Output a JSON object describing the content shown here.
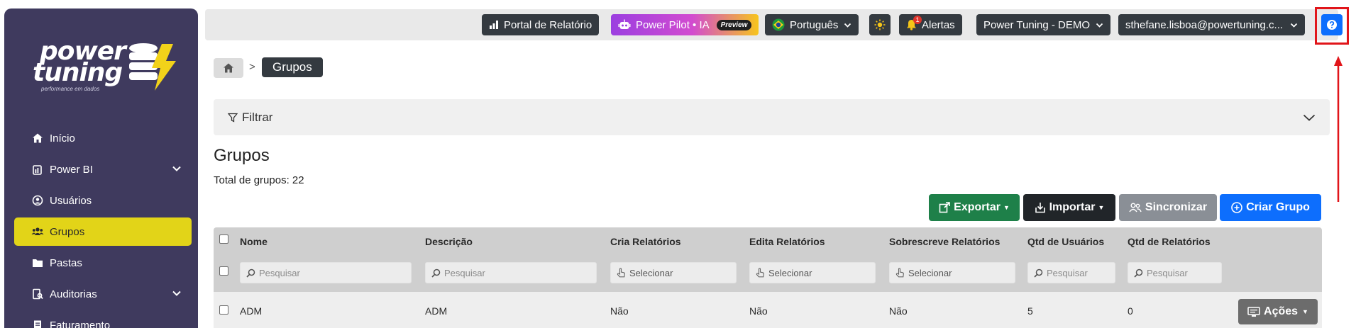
{
  "sidebar": {
    "logo": {
      "line1": "power",
      "line2": "tuning",
      "tagline": "performance em dados"
    },
    "items": [
      {
        "label": "Início",
        "icon": "home-icon"
      },
      {
        "label": "Power BI",
        "icon": "powerbi-icon",
        "expandable": true
      },
      {
        "label": "Usuários",
        "icon": "user-circle-icon"
      },
      {
        "label": "Grupos",
        "icon": "users-icon",
        "active": true
      },
      {
        "label": "Pastas",
        "icon": "folder-icon"
      },
      {
        "label": "Auditorias",
        "icon": "audit-icon",
        "expandable": true
      },
      {
        "label": "Faturamento",
        "icon": "receipt-icon"
      }
    ]
  },
  "topbar": {
    "portal": "Portal de Relatório",
    "pilot": "Power Pilot • IA",
    "pilot_badge": "Preview",
    "language": "Português",
    "alerts": "Alertas",
    "alerts_count": "1",
    "tenant": "Power Tuning - DEMO",
    "user": "sthefane.lisboa@powertuning.c..."
  },
  "breadcrumb": {
    "separator": ">",
    "current": "Grupos"
  },
  "filter": {
    "label": "Filtrar"
  },
  "page": {
    "title": "Grupos",
    "total": "Total de grupos: 22"
  },
  "actions": {
    "export": "Exportar",
    "import": "Importar",
    "sync": "Sincronizar",
    "create": "Criar Grupo"
  },
  "table": {
    "headers": [
      "Nome",
      "Descrição",
      "Cria Relatórios",
      "Edita Relatórios",
      "Sobrescreve Relatórios",
      "Qtd de Usuários",
      "Qtd de Relatórios"
    ],
    "search_placeholder": "Pesquisar",
    "select_placeholder": "Selecionar",
    "rows": [
      {
        "nome": "ADM",
        "descricao": "ADM",
        "cria": "Não",
        "edita": "Não",
        "sobrescreve": "Não",
        "usuarios": "5",
        "relatorios": "0",
        "acoes": "Ações"
      }
    ]
  },
  "colors": {
    "sidebar": "#3f3a5e",
    "active": "#e2d418",
    "primary": "#0d6efd",
    "export": "#1e8049",
    "highlight": "#e1151a"
  }
}
